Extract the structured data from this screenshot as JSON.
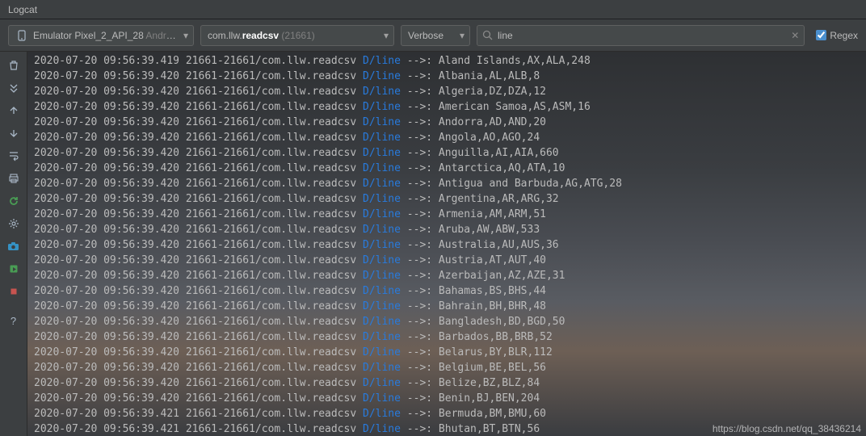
{
  "title": "Logcat",
  "device": {
    "prefix": "Emulator Pixel_2_API_28",
    "suffix": "Android"
  },
  "process": {
    "pkg": "com.llw.",
    "bold": "readcsv",
    "pid": " (21661)"
  },
  "level": "Verbose",
  "search": {
    "placeholder": "",
    "value": "line"
  },
  "regex_label": "Regex",
  "watermark": "https://blog.csdn.net/qq_38436214",
  "log_prefix_common": "21661-21661/com.llw.readcsv ",
  "tag": "D/line",
  "arrow": " -->: ",
  "rows": [
    {
      "ts": "2020-07-20 09:56:39.419",
      "msg": "Aland Islands,AX,ALA,248"
    },
    {
      "ts": "2020-07-20 09:56:39.420",
      "msg": "Albania,AL,ALB,8"
    },
    {
      "ts": "2020-07-20 09:56:39.420",
      "msg": "Algeria,DZ,DZA,12"
    },
    {
      "ts": "2020-07-20 09:56:39.420",
      "msg": "American Samoa,AS,ASM,16"
    },
    {
      "ts": "2020-07-20 09:56:39.420",
      "msg": "Andorra,AD,AND,20"
    },
    {
      "ts": "2020-07-20 09:56:39.420",
      "msg": "Angola,AO,AGO,24"
    },
    {
      "ts": "2020-07-20 09:56:39.420",
      "msg": "Anguilla,AI,AIA,660"
    },
    {
      "ts": "2020-07-20 09:56:39.420",
      "msg": "Antarctica,AQ,ATA,10"
    },
    {
      "ts": "2020-07-20 09:56:39.420",
      "msg": "Antigua and Barbuda,AG,ATG,28"
    },
    {
      "ts": "2020-07-20 09:56:39.420",
      "msg": "Argentina,AR,ARG,32"
    },
    {
      "ts": "2020-07-20 09:56:39.420",
      "msg": "Armenia,AM,ARM,51"
    },
    {
      "ts": "2020-07-20 09:56:39.420",
      "msg": "Aruba,AW,ABW,533"
    },
    {
      "ts": "2020-07-20 09:56:39.420",
      "msg": "Australia,AU,AUS,36"
    },
    {
      "ts": "2020-07-20 09:56:39.420",
      "msg": "Austria,AT,AUT,40"
    },
    {
      "ts": "2020-07-20 09:56:39.420",
      "msg": "Azerbaijan,AZ,AZE,31"
    },
    {
      "ts": "2020-07-20 09:56:39.420",
      "msg": "Bahamas,BS,BHS,44"
    },
    {
      "ts": "2020-07-20 09:56:39.420",
      "msg": "Bahrain,BH,BHR,48"
    },
    {
      "ts": "2020-07-20 09:56:39.420",
      "msg": "Bangladesh,BD,BGD,50"
    },
    {
      "ts": "2020-07-20 09:56:39.420",
      "msg": "Barbados,BB,BRB,52"
    },
    {
      "ts": "2020-07-20 09:56:39.420",
      "msg": "Belarus,BY,BLR,112"
    },
    {
      "ts": "2020-07-20 09:56:39.420",
      "msg": "Belgium,BE,BEL,56"
    },
    {
      "ts": "2020-07-20 09:56:39.420",
      "msg": "Belize,BZ,BLZ,84"
    },
    {
      "ts": "2020-07-20 09:56:39.420",
      "msg": "Benin,BJ,BEN,204"
    },
    {
      "ts": "2020-07-20 09:56:39.421",
      "msg": "Bermuda,BM,BMU,60"
    },
    {
      "ts": "2020-07-20 09:56:39.421",
      "msg": "Bhutan,BT,BTN,56"
    }
  ]
}
